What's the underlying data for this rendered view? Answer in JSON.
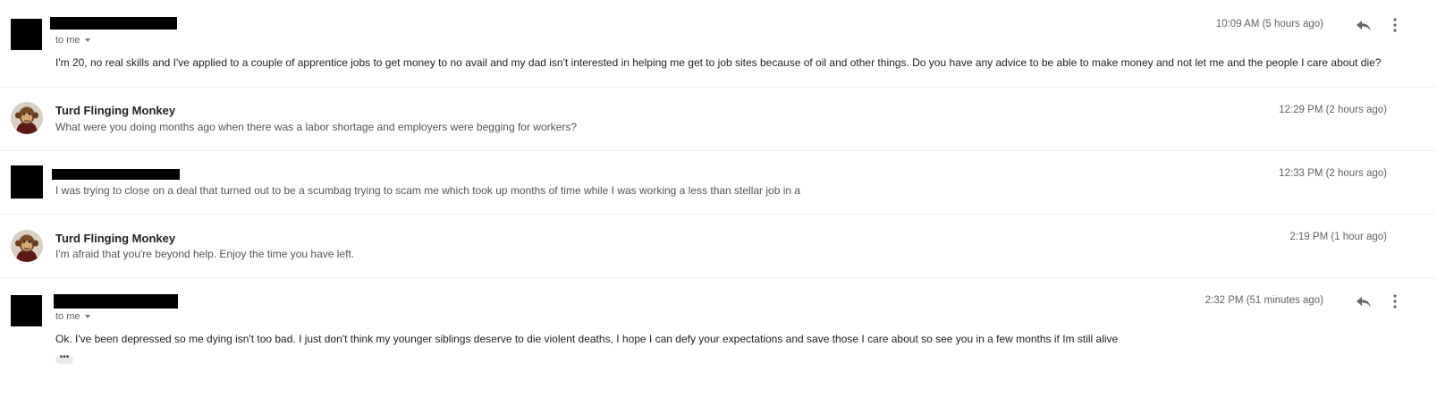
{
  "messages": [
    {
      "sender": "",
      "to": "to me",
      "time": "10:09 AM (5 hours ago)",
      "body": "I'm 20, no real skills and I've applied to a couple of apprentice jobs to get money to no avail and my dad isn't interested in helping me get to job sites because of oil and other things. Do you have any advice to be able to make money and not let me and the people I care about die?"
    },
    {
      "sender": "Turd Flinging Monkey",
      "time": "12:29 PM (2 hours ago)",
      "body": "What were you doing months ago when there was a labor shortage and employers were begging for workers?"
    },
    {
      "sender": "",
      "time": "12:33 PM (2 hours ago)",
      "body": "I was trying to close on a deal that turned out to be a scumbag trying to scam me which took up months of time while I was working a less than stellar job in a"
    },
    {
      "sender": "Turd Flinging Monkey",
      "time": "2:19 PM (1 hour ago)",
      "body": "I'm afraid that you're beyond help. Enjoy the time you have left."
    },
    {
      "sender": "",
      "to": "to me",
      "time": "2:32 PM (51 minutes ago)",
      "body": "Ok. I've been depressed so me dying isn't too bad. I just don't think my younger siblings deserve to die violent deaths, I hope I can defy your expectations and save those I care about so see you in a few months if Im still alive",
      "trimmed": "•••"
    }
  ],
  "icons": {
    "reply": "reply-icon",
    "more": "more-vert-icon",
    "avatar": "monkey-avatar-icon"
  }
}
